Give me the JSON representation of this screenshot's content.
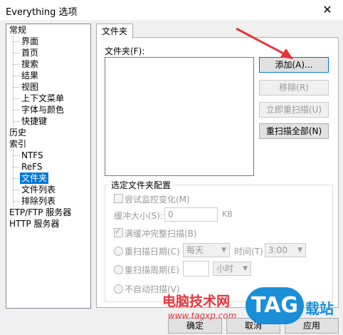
{
  "window": {
    "title": "Everything 选项",
    "close_glyph": "✕"
  },
  "tree": {
    "items": [
      "常规",
      "界面",
      "首页",
      "搜索",
      "结果",
      "视图",
      "上下文菜单",
      "字体与颜色",
      "快捷键",
      "历史",
      "索引",
      "NTFS",
      "ReFS",
      "文件夹",
      "文件列表",
      "排除列表",
      "ETP/FTP 服务器",
      "HTTP 服务器"
    ],
    "selected": "文件夹"
  },
  "tab": {
    "label": "文件夹"
  },
  "folders": {
    "label": "文件夹(F):",
    "add": "添加(A)...",
    "remove": "移除(R)",
    "rescan_now": "立即重扫描(U)",
    "rescan_all": "重扫描全部(N)"
  },
  "config": {
    "title": "选定文件夹配置",
    "monitor": "尝试监控变化(M)",
    "buffer_label": "缓冲大小(S):",
    "buffer_value": "0",
    "buffer_unit": "KB",
    "rescan_full": "满缓冲完整扫描(B)",
    "rescan_day": "重扫描日期(C)",
    "day_value": "每天",
    "time_label": "时间(T)",
    "time_value": "3:00",
    "rescan_period": "重扫描周期(E)",
    "period_unit": "小时",
    "no_auto": "不自动扫描(V)"
  },
  "buttons": {
    "ok": "确定",
    "cancel": "取消",
    "apply": "应用"
  },
  "watermark": {
    "cn": "电脑技术网",
    "url": "www.tagxp.com",
    "tag": "TAG",
    "zhan": "载站"
  },
  "colors": {
    "selection": "#0078d7",
    "annotation_arrow": "#e8353a",
    "tag_blue": "#1a8fd8"
  }
}
